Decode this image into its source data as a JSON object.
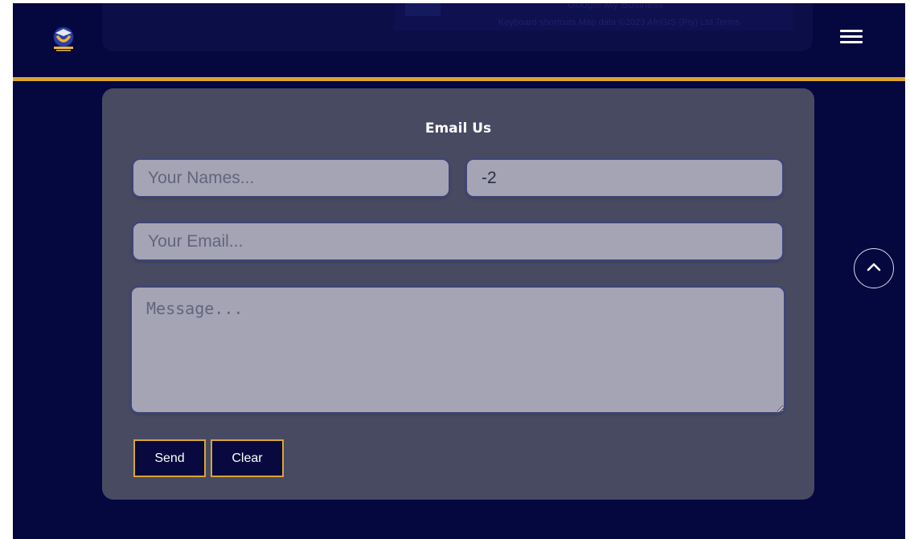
{
  "map": {
    "title": "Google My Business",
    "attribution": "Keyboard shortcuts    Map data ©2023 AfriGIS (Pty) Ltd    Terms"
  },
  "header": {
    "logo_icon": "school-logo-icon",
    "menu_icon": "hamburger-menu-icon"
  },
  "form": {
    "title": "Email Us",
    "name_placeholder": "Your Names...",
    "phone_value": "-2",
    "email_placeholder": "Your Email...",
    "message_placeholder": "Message...",
    "send_label": "Send",
    "clear_label": "Clear"
  },
  "scroll_top_icon": "chevron-up-icon",
  "colors": {
    "background": "#05073f",
    "accent": "#d9a531",
    "card": "#484a62",
    "field": "#a4a4b5"
  }
}
